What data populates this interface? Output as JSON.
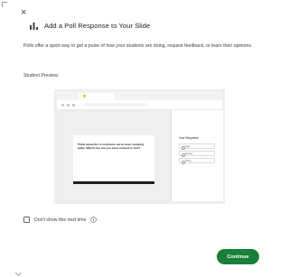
{
  "dialog": {
    "close_symbol": "×",
    "title": "Add a Poll Response to Your Slide",
    "title_icon": "bar-chart-icon",
    "description": "Polls offer a quick way to get a pulse of how your students are doing, request feedback, or learn their opinions.",
    "preview_label": "Student Preview:"
  },
  "preview": {
    "question": "Think about the 3 continents we've been studying lately. Which one are you most excited to visit?",
    "panel_heading": "Your Response",
    "options": [
      "Asia",
      "Europe",
      "Africa"
    ]
  },
  "footer": {
    "dont_show_label": "Don't show this next time",
    "dont_show_checked": false,
    "info_icon": "info-icon",
    "continue_label": "Continue"
  },
  "colors": {
    "primary_button": "#188038",
    "preview_background": "#eceeef"
  }
}
